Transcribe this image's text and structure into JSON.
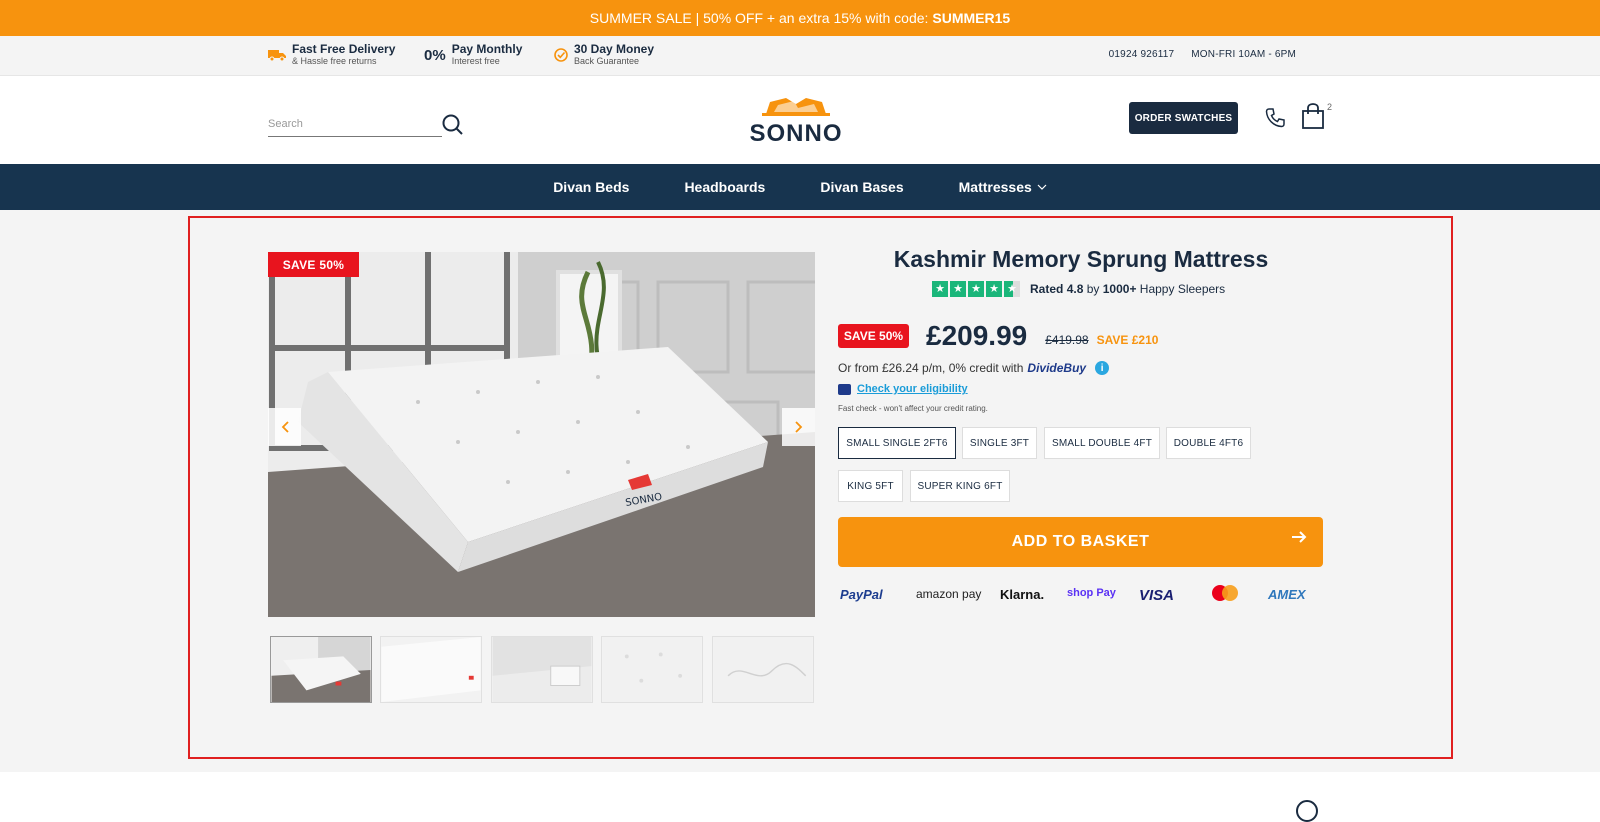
{
  "promo": {
    "text": "SUMMER SALE | 50% OFF + an extra 15% with code:",
    "code": "SUMMER15"
  },
  "usps": [
    {
      "title": "Fast Free Delivery",
      "sub": "& Hassle free returns",
      "icon": "truck-icon"
    },
    {
      "title": "Pay Monthly",
      "sub": "Interest free",
      "prefix": "0%"
    },
    {
      "title": "30 Day Money",
      "sub": "Back Guarantee",
      "icon": "check-badge-icon"
    }
  ],
  "contact": {
    "phone": "01924 926117",
    "hours": "MON-FRI 10AM - 6PM"
  },
  "header": {
    "search_placeholder": "Search",
    "logo": "SONNO",
    "swatches_label": "ORDER SWATCHES",
    "cart_count": "2"
  },
  "nav": [
    {
      "label": "Divan Beds"
    },
    {
      "label": "Headboards"
    },
    {
      "label": "Divan Bases"
    },
    {
      "label": "Mattresses",
      "has_dropdown": true
    }
  ],
  "product": {
    "title": "Kashmir Memory Sprung Mattress",
    "image_tag": "SAVE 50%",
    "image_brand": "SONNO",
    "rating_prefix": "Rated",
    "rating_value": "4.8",
    "rating_by": "by",
    "rating_count": "1000+",
    "rating_suffix": "Happy Sleepers",
    "stars": 4.5,
    "save_tag": "SAVE 50%",
    "price": "£209.99",
    "was_price": "£419.98",
    "save_amount": "SAVE £210",
    "credit_text": "Or from £26.24 p/m, 0% credit with",
    "credit_brand": "DivideBuy",
    "eligibility_link": "Check your eligibility",
    "fastcheck_note": "Fast check - won't affect your credit rating.",
    "sizes": [
      "SMALL SINGLE 2FT6",
      "SINGLE 3FT",
      "SMALL DOUBLE 4FT",
      "DOUBLE 4FT6",
      "KING 5FT",
      "SUPER KING 6FT"
    ],
    "selected_size": "SMALL SINGLE 2FT6",
    "add_to_basket": "ADD TO BASKET"
  },
  "payments": [
    "PayPal",
    "amazon pay",
    "Klarna.",
    "shop Pay",
    "VISA",
    "mastercard",
    "AMEX"
  ],
  "colors": {
    "accent": "#f7930e",
    "navy": "#17344f",
    "sale_red": "#e8141e",
    "trust_green": "#1ab67a"
  }
}
